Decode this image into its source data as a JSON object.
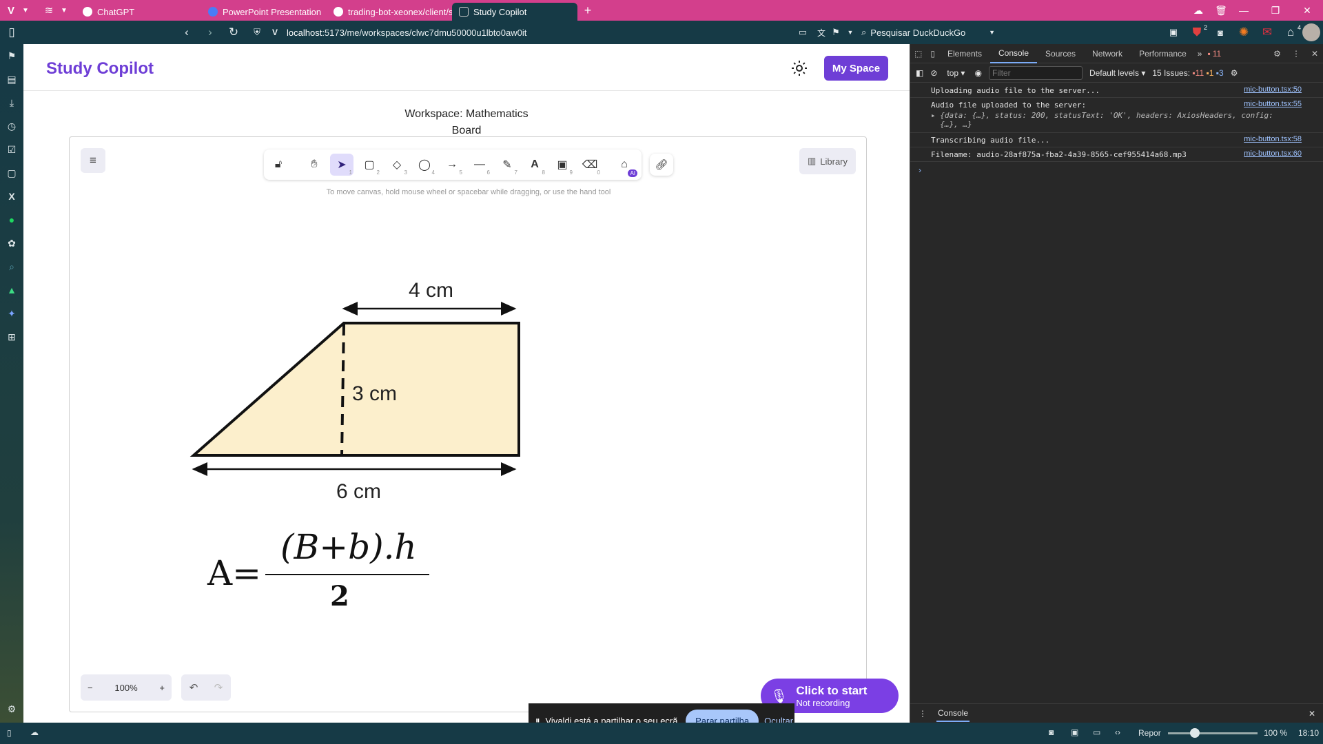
{
  "browser": {
    "tabs": [
      {
        "label": "ChatGPT",
        "color": "#ffffff"
      },
      {
        "label": "PowerPoint Presentation",
        "color": "#4a7cf7"
      },
      {
        "label": "trading-bot-xeonex/client/s",
        "color": "#ffffff"
      },
      {
        "label": "Study Copilot",
        "color": "#e8e8e8"
      }
    ],
    "url_host": "localhost",
    "url_path": ":5173/me/workspaces/clwc7dmu50000u1lbto0aw0it",
    "search_placeholder": "Pesquisar DuckDuckGo",
    "ext_badges": {
      "ublock": "2",
      "notif": "4"
    }
  },
  "app": {
    "title": "Study Copilot",
    "my_space": "My Space",
    "workspace_line1": "Workspace: Mathematics",
    "workspace_line2": "Board",
    "library": "Library",
    "hint": "To move canvas, hold mouse wheel or spacebar while dragging, or use the hand tool",
    "tool_numbers": [
      "1",
      "2",
      "3",
      "4",
      "5",
      "6",
      "7",
      "8",
      "9",
      "0"
    ],
    "ai_badge": "AI",
    "zoom": "100%",
    "mic_title": "Click to start",
    "mic_sub": "Not recording",
    "drawing": {
      "top_label": "4 cm",
      "height_label": "3 cm",
      "bottom_label": "6 cm",
      "formula_lhs": "A=",
      "formula_num": "(B+b).h",
      "formula_den": "2",
      "fill": "#fcefcc"
    }
  },
  "sharebar": {
    "message": "Vivaldi está a partilhar o seu ecrã.",
    "stop": "Parar partilha",
    "hide": "Ocultar"
  },
  "devtools": {
    "tabs": [
      "Elements",
      "Console",
      "Sources",
      "Network",
      "Performance"
    ],
    "error_count": "11",
    "context": "top",
    "filter_placeholder": "Filter",
    "levels": "Default levels",
    "issues_label": "15 Issues:",
    "issues_err": "11",
    "issues_warn": "1",
    "issues_info": "3",
    "logs": [
      {
        "text": "Uploading audio file to the server...",
        "src": "mic-button.tsx:50"
      },
      {
        "text": "Audio file uploaded to the server:",
        "src": "mic-button.tsx:55"
      },
      {
        "text": "Transcribing audio file...",
        "src": "mic-button.tsx:58"
      },
      {
        "text": "Filename: audio-28af875a-fba2-4a39-8565-cef955414a68.mp3",
        "src": "mic-button.tsx:60"
      }
    ],
    "log_object_line1": "{data: {…}, status: 200, statusText: 'OK', headers: AxiosHeaders, config:",
    "log_object_line2": "{…}, …}",
    "drawer_tab": "Console"
  },
  "statusbar": {
    "reset": "Repor",
    "zoom": "100 %",
    "zoom_level": 0.3,
    "time": "18:10"
  }
}
